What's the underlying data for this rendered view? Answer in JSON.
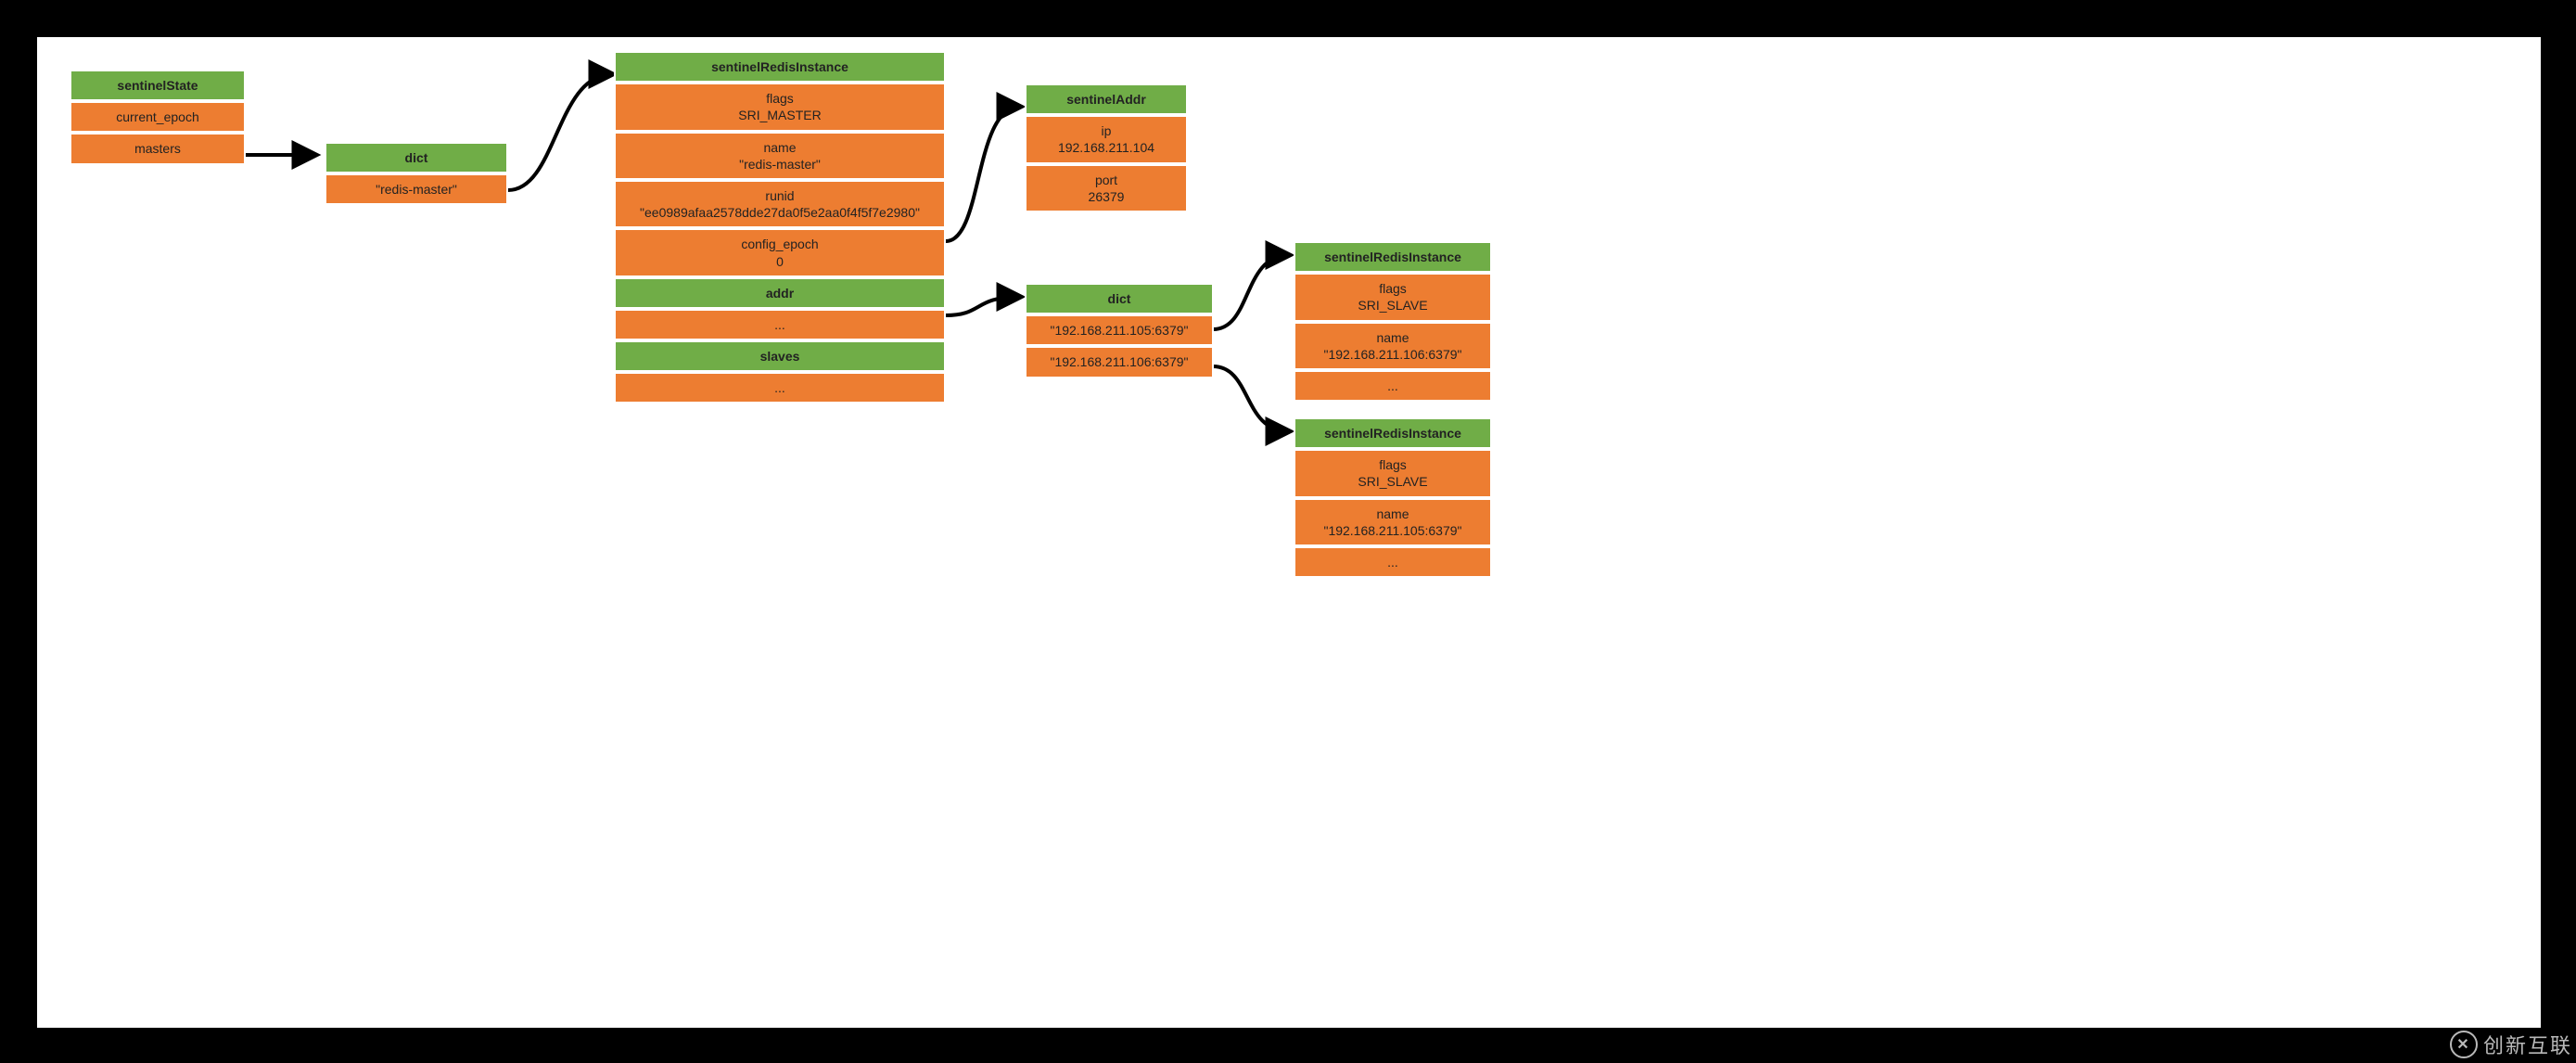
{
  "sentinelState": {
    "title": "sentinelState",
    "rows": [
      "current_epoch",
      "masters"
    ]
  },
  "dict1": {
    "title": "dict",
    "rows": [
      "\"redis-master\""
    ]
  },
  "instanceMaster": {
    "title": "sentinelRedisInstance",
    "rows": [
      "flags\nSRI_MASTER",
      "name\n\"redis-master\"",
      "runid\n\"ee0989afaa2578dde27da0f5e2aa0f4f5f7e2980\"",
      "config_epoch\n0"
    ],
    "addrLabel": "addr",
    "addrAfter": "...",
    "slavesLabel": "slaves",
    "slavesAfter": "..."
  },
  "sentinelAddr": {
    "title": "sentinelAddr",
    "rows": [
      "ip\n192.168.211.104",
      "port\n26379"
    ]
  },
  "dict2": {
    "title": "dict",
    "rows": [
      "\"192.168.211.105:6379\"",
      "\"192.168.211.106:6379\""
    ]
  },
  "slave1": {
    "title": "sentinelRedisInstance",
    "rows": [
      "flags\nSRI_SLAVE",
      "name\n\"192.168.211.106:6379\"",
      "..."
    ]
  },
  "slave2": {
    "title": "sentinelRedisInstance",
    "rows": [
      "flags\nSRI_SLAVE",
      "name\n\"192.168.211.105:6379\"",
      "..."
    ]
  },
  "watermark": "创新互联"
}
